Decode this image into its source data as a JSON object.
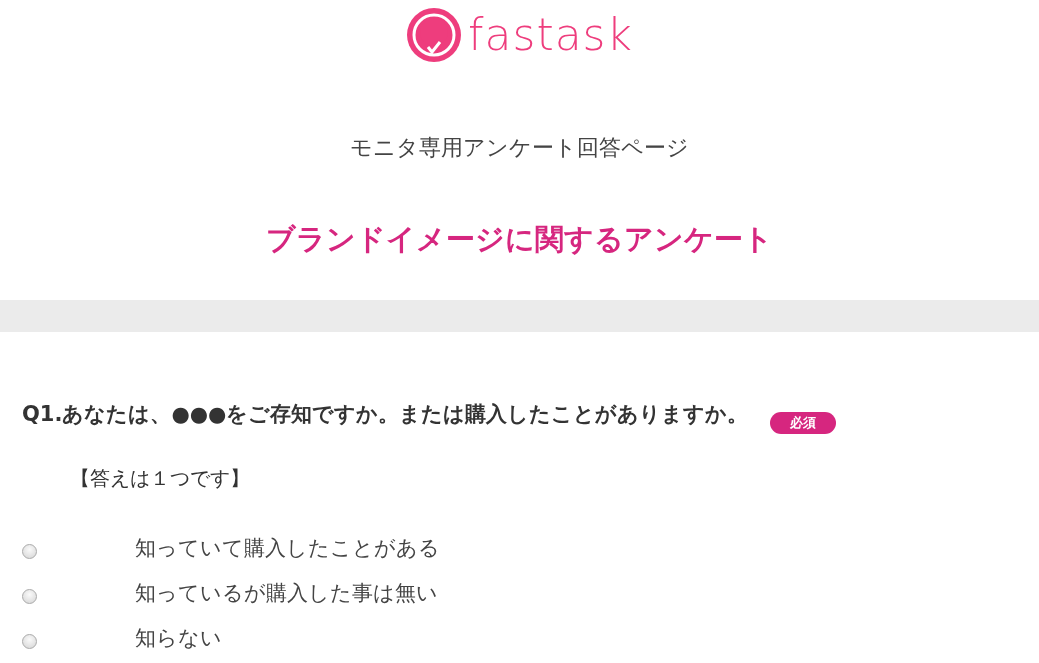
{
  "header": {
    "logo": "fastask",
    "subtitle": "モニタ専用アンケート回答ページ",
    "title": "ブランドイメージに関するアンケート"
  },
  "question": {
    "text": "Q1.あなたは、●●●をご存知ですか。または購入したことがありますか。",
    "badge": "必須",
    "instruction": "【答えは１つです】",
    "options": [
      {
        "label": "知っていて購入したことがある",
        "selected": false
      },
      {
        "label": "知っているが購入した事は無い",
        "selected": false
      },
      {
        "label": "知らない",
        "selected": false
      }
    ]
  }
}
